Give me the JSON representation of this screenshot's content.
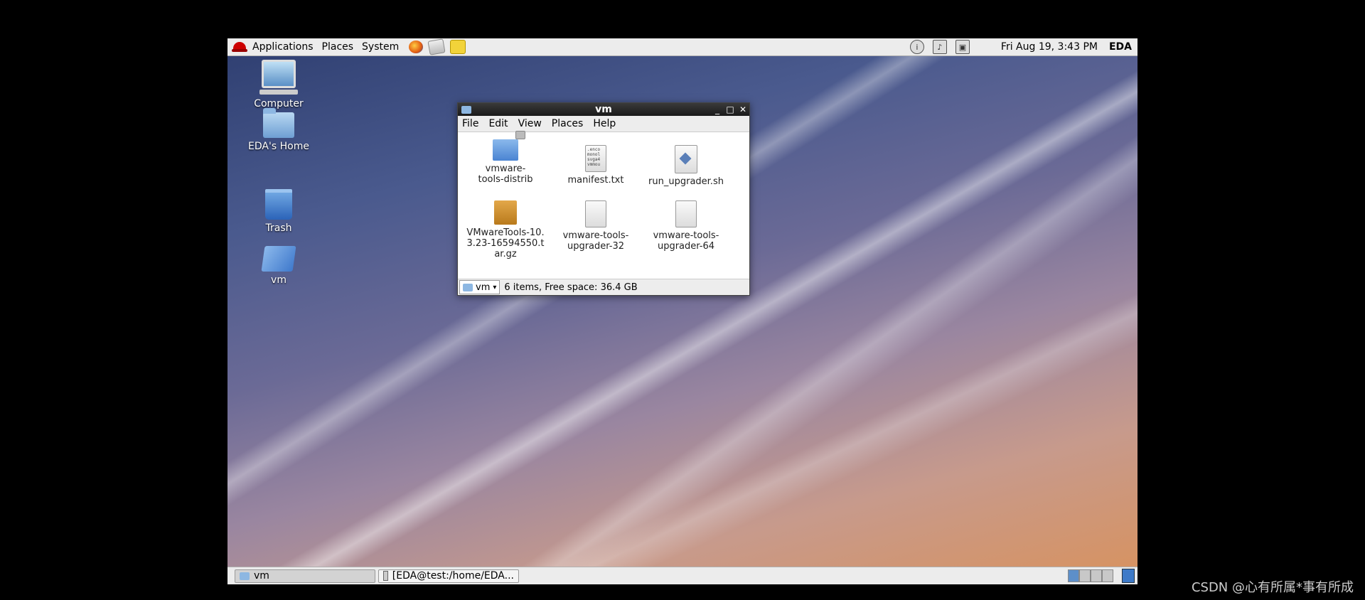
{
  "top_panel": {
    "menus": [
      "Applications",
      "Places",
      "System"
    ],
    "clock": "Fri Aug 19,  3:43 PM",
    "user": "EDA"
  },
  "desktop_icons": [
    {
      "label": "Computer"
    },
    {
      "label": "EDA's Home"
    },
    {
      "label": "Trash"
    },
    {
      "label": "vm"
    }
  ],
  "window": {
    "title": "vm",
    "buttons": {
      "minimize": "_",
      "maximize": "□",
      "close": "✕"
    },
    "menu": [
      "File",
      "Edit",
      "View",
      "Places",
      "Help"
    ],
    "files": [
      {
        "name": "vmware-tools-distrib",
        "icon": "locked-folder-icon"
      },
      {
        "name": "manifest.txt",
        "icon": "text-file-icon",
        "preview": ".enco monol svga4 vmmou"
      },
      {
        "name": "run_upgrader.sh",
        "icon": "script-file-icon"
      },
      {
        "name": "VMwareTools-10.3.23-16594550.tar.gz",
        "icon": "archive-icon"
      },
      {
        "name": "vmware-tools-upgrader-32",
        "icon": "file-icon"
      },
      {
        "name": "vmware-tools-upgrader-64",
        "icon": "file-icon"
      }
    ],
    "status": {
      "location": "vm",
      "text": "6 items, Free space: 36.4 GB"
    }
  },
  "taskbar": {
    "tasks": [
      {
        "label": "vm",
        "active": true
      },
      {
        "label": "[EDA@test:/home/EDA...",
        "active": false
      }
    ]
  },
  "watermark": "CSDN @心有所属*事有所成"
}
